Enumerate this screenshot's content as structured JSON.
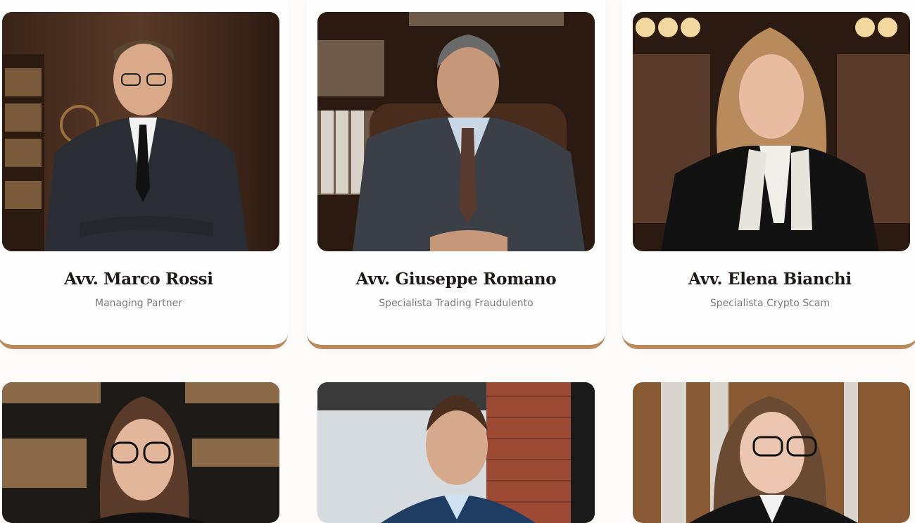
{
  "team": {
    "members": [
      {
        "name": "Avv. Marco Rossi",
        "role": "Managing Partner",
        "photo_icon": "lawyer-portrait"
      },
      {
        "name": "Avv. Giuseppe Romano",
        "role": "Specialista Trading Fraudulento",
        "photo_icon": "lawyer-portrait"
      },
      {
        "name": "Avv. Elena Bianchi",
        "role": "Specialista Crypto Scam",
        "photo_icon": "lawyer-portrait"
      }
    ],
    "second_row_photos": [
      "lawyer-portrait",
      "lawyer-portrait",
      "lawyer-portrait"
    ]
  },
  "colors": {
    "accent": "#b98b5c",
    "name_text": "#1f1a17",
    "role_text": "#7a7a7a",
    "background": "#fdfcfb"
  }
}
